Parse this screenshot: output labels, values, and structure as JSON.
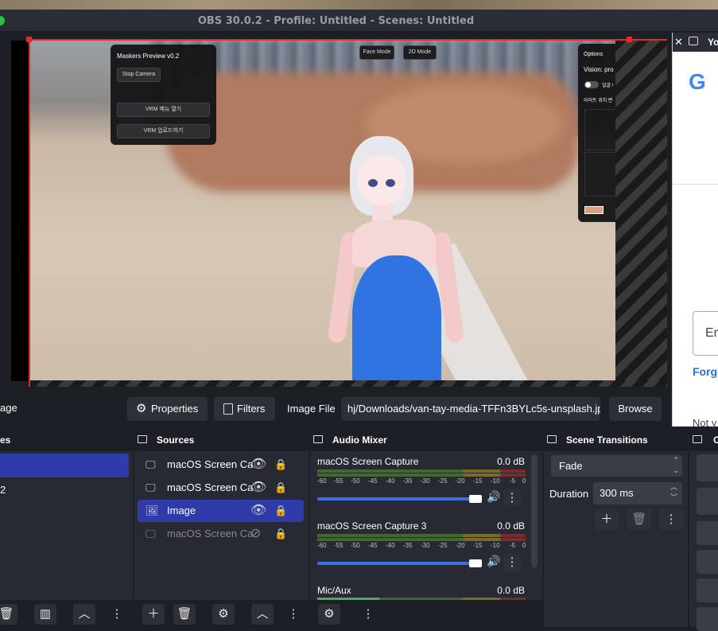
{
  "window": {
    "title": "OBS 30.0.2 - Profile: Untitled - Scenes: Untitled"
  },
  "preview": {
    "masker_panel": {
      "title": "Maskers Preview v0.2",
      "stop_camera": "Stop Camera",
      "vrm_menu": "VRM 메뉴 열기",
      "vrm_upload": "VRM 업로드하기"
    },
    "mode_buttons": {
      "face": "Face Mode",
      "mode2d": "2D Mode"
    },
    "options_panel": {
      "title": "Options",
      "vision": "Vision: pro",
      "toggle_label": "얼굴 !",
      "light_label": "라이트 위치 변"
    }
  },
  "browser": {
    "tab": "Yo",
    "email_placeholder": "En",
    "forgot": "Forgo",
    "notyou": "Not y"
  },
  "toolbar": {
    "source_name": "age",
    "properties": "Properties",
    "filters": "Filters",
    "image_file_label": "Image File",
    "image_file_value": "hj/Downloads/van-tay-media-TFFn3BYLc5s-unsplash.jpg",
    "browse": "Browse"
  },
  "scenes": {
    "title": "es",
    "items": [
      "",
      "2"
    ]
  },
  "sources": {
    "title": "Sources",
    "items": [
      {
        "name": "macOS Screen Ca",
        "type": "monitor",
        "visible": true,
        "selected": false
      },
      {
        "name": "macOS Screen Ca",
        "type": "monitor",
        "visible": true,
        "selected": false
      },
      {
        "name": "Image",
        "type": "image",
        "visible": true,
        "selected": true
      },
      {
        "name": "macOS Screen Ca",
        "type": "monitor",
        "visible": false,
        "selected": false
      }
    ]
  },
  "audio_mixer": {
    "title": "Audio Mixer",
    "channels": [
      {
        "name": "macOS Screen Capture",
        "db": "0.0 dB",
        "volume_level": 0.96
      },
      {
        "name": "macOS Screen Capture 3",
        "db": "0.0 dB",
        "volume_level": 0.96
      },
      {
        "name": "Mic/Aux",
        "db": "0.0 dB",
        "volume_level": 0.96
      }
    ],
    "scale": [
      "-60",
      "-55",
      "-50",
      "-45",
      "-40",
      "-35",
      "-30",
      "-25",
      "-20",
      "-15",
      "-10",
      "-5",
      "0"
    ]
  },
  "transitions": {
    "title": "Scene Transitions",
    "selected": "Fade",
    "duration_label": "Duration",
    "duration_value": "300 ms"
  },
  "controls": {
    "title": "C"
  },
  "colors": {
    "accent": "#2e3ba8",
    "selection": "#e02b2b",
    "slider": "#3d6ee6"
  }
}
